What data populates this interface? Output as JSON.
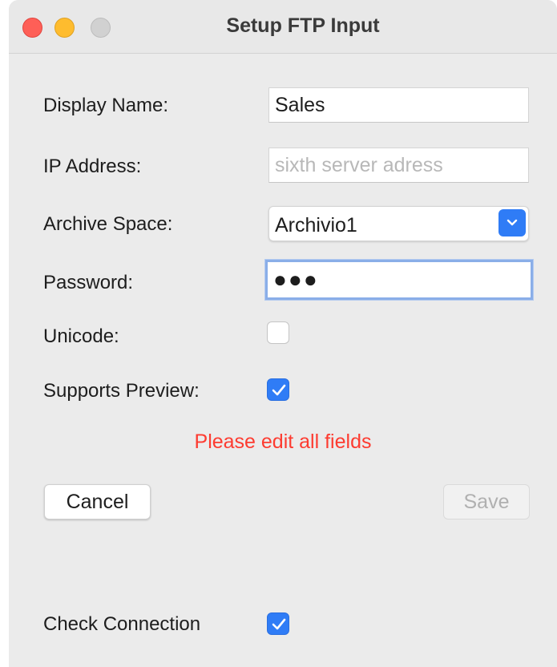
{
  "window": {
    "title": "Setup FTP Input"
  },
  "form": {
    "display_name": {
      "label": "Display Name:",
      "value": "Sales"
    },
    "ip_address": {
      "label": "IP Address:",
      "value": "",
      "placeholder": "sixth server adress"
    },
    "archive_space": {
      "label": "Archive Space:",
      "selected": "Archivio1"
    },
    "password": {
      "label": "Password:",
      "value": "●●●"
    },
    "unicode": {
      "label": "Unicode:",
      "checked": false
    },
    "supports_preview": {
      "label": "Supports Preview:",
      "checked": true
    },
    "error_message": "Please edit all fields",
    "check_connection": {
      "label": "Check Connection",
      "checked": true
    }
  },
  "buttons": {
    "cancel_label": "Cancel",
    "save_label": "Save"
  },
  "colors": {
    "accent": "#2f7cf6",
    "error": "#fd3b30",
    "window_bg": "#ebebeb"
  },
  "icons": {
    "window_close": "close-traffic-light",
    "window_minimize": "minimize-traffic-light",
    "window_zoom": "zoom-traffic-light",
    "select_arrow": "chevron-down-icon",
    "checkmark": "checkmark-icon"
  }
}
